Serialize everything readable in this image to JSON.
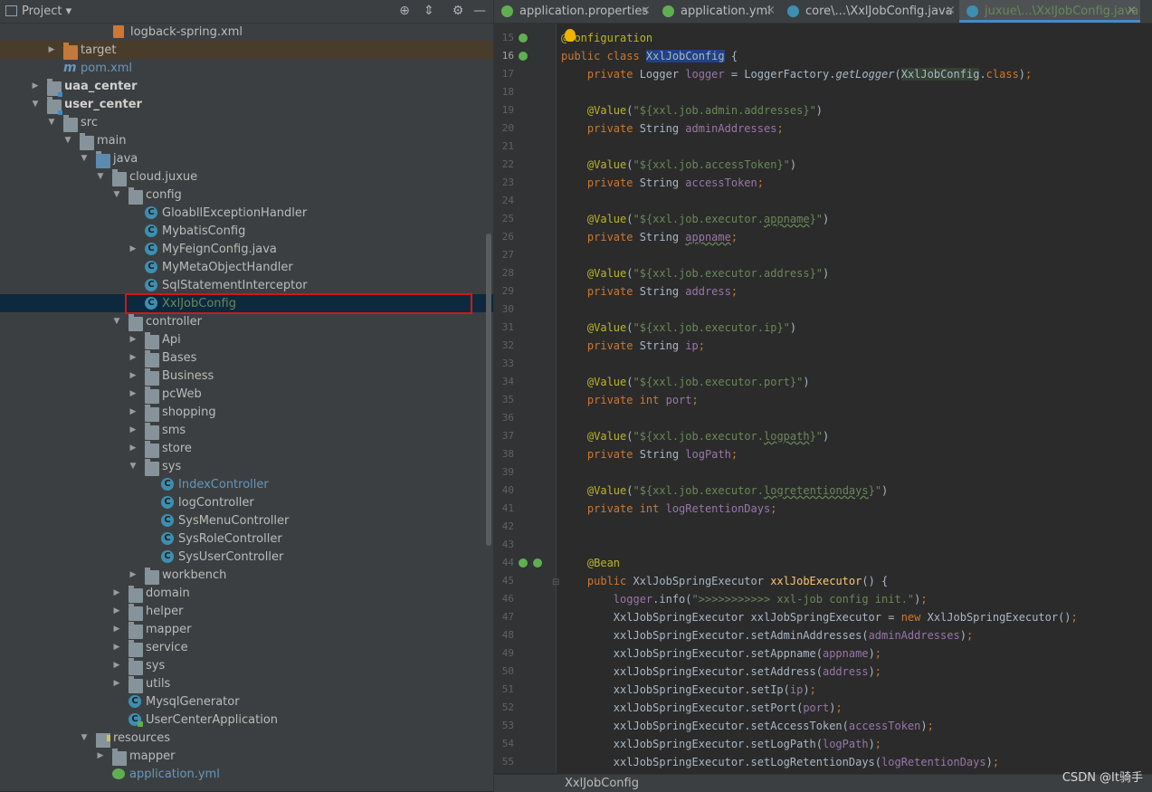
{
  "project_panel": {
    "title": "Project",
    "tree": [
      {
        "label": "logback-spring.xml",
        "icon": "xml-file-icon",
        "indent": 125
      },
      {
        "label": "target",
        "icon": "folder-excluded-icon",
        "indent": 70,
        "arrow": "collapsed"
      },
      {
        "label": "pom.xml",
        "icon": "maven-icon",
        "indent": 70
      },
      {
        "label": "uaa_center",
        "icon": "module-folder-icon",
        "indent": 52,
        "arrow": "collapsed"
      },
      {
        "label": "user_center",
        "icon": "module-folder-icon",
        "indent": 52,
        "arrow": "expanded"
      },
      {
        "label": "src",
        "icon": "folder-icon",
        "indent": 70,
        "arrow": "expanded"
      },
      {
        "label": "main",
        "icon": "folder-icon",
        "indent": 88,
        "arrow": "expanded"
      },
      {
        "label": "java",
        "icon": "source-folder-icon",
        "indent": 106,
        "arrow": "expanded"
      },
      {
        "label": "cloud.juxue",
        "icon": "package-icon",
        "indent": 124,
        "arrow": "expanded"
      },
      {
        "label": "config",
        "icon": "package-icon",
        "indent": 142,
        "arrow": "expanded"
      },
      {
        "label": "GloabllExceptionHandler",
        "icon": "class-icon",
        "indent": 160
      },
      {
        "label": "MybatisConfig",
        "icon": "class-icon",
        "indent": 160
      },
      {
        "label": "MyFeignConfig.java",
        "icon": "class-icon",
        "indent": 160,
        "arrow": "collapsed"
      },
      {
        "label": "MyMetaObjectHandler",
        "icon": "class-icon",
        "indent": 160
      },
      {
        "label": "SqlStatementInterceptor",
        "icon": "class-icon",
        "indent": 160
      },
      {
        "label": "XxlJobConfig",
        "icon": "class-icon",
        "indent": 160
      },
      {
        "label": "controller",
        "icon": "package-icon",
        "indent": 142,
        "arrow": "expanded"
      },
      {
        "label": "Api",
        "icon": "package-icon",
        "indent": 160,
        "arrow": "collapsed"
      },
      {
        "label": "Bases",
        "icon": "package-icon",
        "indent": 160,
        "arrow": "collapsed"
      },
      {
        "label": "Business",
        "icon": "package-icon",
        "indent": 160,
        "arrow": "collapsed"
      },
      {
        "label": "pcWeb",
        "icon": "package-icon",
        "indent": 160,
        "arrow": "collapsed"
      },
      {
        "label": "shopping",
        "icon": "package-icon",
        "indent": 160,
        "arrow": "collapsed"
      },
      {
        "label": "sms",
        "icon": "package-icon",
        "indent": 160,
        "arrow": "collapsed"
      },
      {
        "label": "store",
        "icon": "package-icon",
        "indent": 160,
        "arrow": "collapsed"
      },
      {
        "label": "sys",
        "icon": "package-icon",
        "indent": 160,
        "arrow": "expanded"
      },
      {
        "label": "IndexController",
        "icon": "class-icon",
        "indent": 178
      },
      {
        "label": "logController",
        "icon": "class-icon",
        "indent": 178
      },
      {
        "label": "SysMenuController",
        "icon": "class-icon",
        "indent": 178
      },
      {
        "label": "SysRoleController",
        "icon": "class-icon",
        "indent": 178
      },
      {
        "label": "SysUserController",
        "icon": "class-icon",
        "indent": 178
      },
      {
        "label": "workbench",
        "icon": "package-icon",
        "indent": 160,
        "arrow": "collapsed"
      },
      {
        "label": "domain",
        "icon": "package-icon",
        "indent": 142,
        "arrow": "collapsed"
      },
      {
        "label": "helper",
        "icon": "package-icon",
        "indent": 142,
        "arrow": "collapsed"
      },
      {
        "label": "mapper",
        "icon": "package-icon",
        "indent": 142,
        "arrow": "collapsed"
      },
      {
        "label": "service",
        "icon": "package-icon",
        "indent": 142,
        "arrow": "collapsed"
      },
      {
        "label": "sys",
        "icon": "package-icon",
        "indent": 142,
        "arrow": "collapsed"
      },
      {
        "label": "utils",
        "icon": "package-icon",
        "indent": 142,
        "arrow": "collapsed"
      },
      {
        "label": "MysqlGenerator",
        "icon": "class-icon",
        "indent": 142
      },
      {
        "label": "UserCenterApplication",
        "icon": "spring-boot-class-icon",
        "indent": 142
      },
      {
        "label": "resources",
        "icon": "resources-folder-icon",
        "indent": 106,
        "arrow": "expanded"
      },
      {
        "label": "mapper",
        "icon": "folder-icon",
        "indent": 124,
        "arrow": "collapsed"
      },
      {
        "label": "application.yml",
        "icon": "yml-file-icon",
        "indent": 124
      }
    ]
  },
  "editor": {
    "tabs": [
      {
        "label": "application.properties",
        "icon": "spring-leaf-icon"
      },
      {
        "label": "application.yml",
        "icon": "spring-leaf-icon"
      },
      {
        "label": "core\\...\\XxlJobConfig.java",
        "icon": "class-icon"
      },
      {
        "label": "juxue\\...\\XxlJobConfig.java",
        "icon": "class-icon",
        "active": true
      }
    ],
    "line_numbers": [
      "15",
      "16",
      "17",
      "18",
      "19",
      "20",
      "21",
      "22",
      "23",
      "24",
      "25",
      "26",
      "27",
      "28",
      "29",
      "30",
      "31",
      "32",
      "33",
      "34",
      "35",
      "36",
      "37",
      "38",
      "39",
      "40",
      "41",
      "42",
      "43",
      "44",
      "45",
      "46",
      "47",
      "48",
      "49",
      "50",
      "51",
      "52",
      "53",
      "54",
      "55"
    ],
    "breadcrumb": "XxlJobConfig"
  },
  "watermark": "CSDN @It骑手",
  "colors": {
    "selection_box": "#d01818",
    "active_tab_underline": "#4a88c7",
    "keyword": "#cc7832",
    "annotation": "#bbb529",
    "string": "#6a8759",
    "field": "#9876aa"
  }
}
